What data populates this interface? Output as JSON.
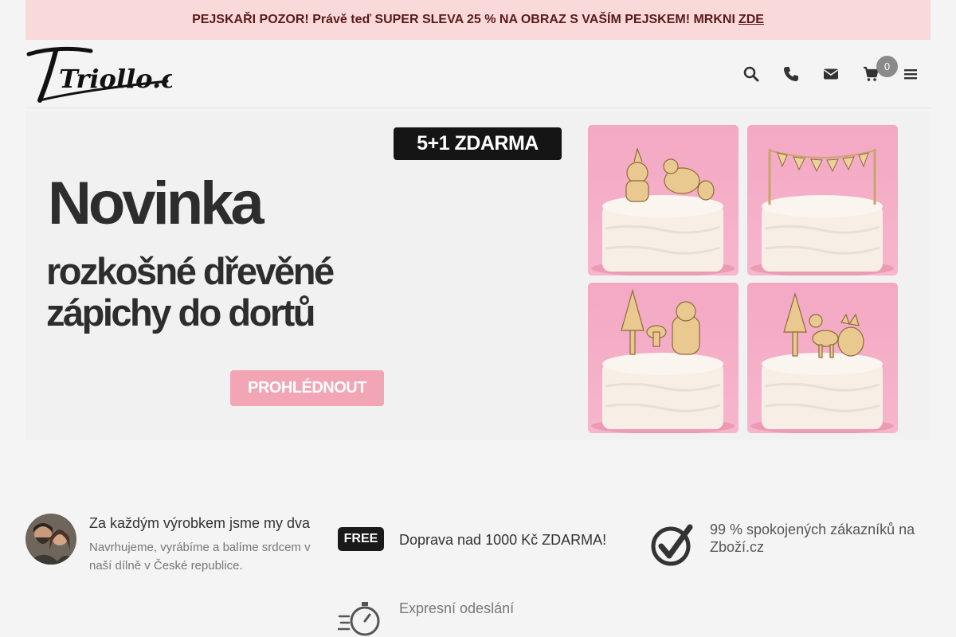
{
  "promo": {
    "text": "PEJSKAŘI POZOR! Právě teď SUPER SLEVA 25 % NA OBRAZ S VAŠÍM PEJSKEM! MRKNI",
    "link": "ZDE"
  },
  "header": {
    "logo_text": "Triollo.cz",
    "cart_count": "0",
    "icons": [
      "search-icon",
      "phone-icon",
      "envelope-icon",
      "cart-icon",
      "menu-icon"
    ]
  },
  "hero": {
    "badge": "5+1 ZDARMA",
    "title": "Novinka",
    "subtitle_line1": "rozkošné dřevěné",
    "subtitle_line2": "zápichy do dortů",
    "button": "PROHLÉDNOUT"
  },
  "features": {
    "team_title": "Za každým výrobkem jsme my dva",
    "team_text": "Navrhujeme, vyrábíme a balíme srdcem v naší dílně v České republice.",
    "free_badge": "FREE",
    "shipping": "Doprava nad 1000 Kč ZDARMA!",
    "satisfaction": "99 % spokojených zákazníků na Zboží.cz",
    "express": "Expresní odeslání"
  },
  "colors": {
    "promo_bg": "#f9d9d9",
    "promo_text": "#5a1a1a",
    "button_pink": "#f2a5b4",
    "photo_pink": "#f4a8c3"
  }
}
